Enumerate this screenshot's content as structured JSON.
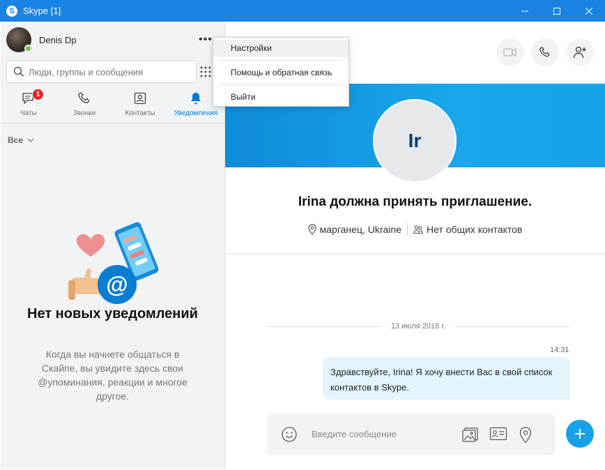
{
  "window": {
    "title": "Skype [1]",
    "app_icon": "S"
  },
  "profile": {
    "name": "Denis Dp",
    "status_color": "#6cc24a",
    "more_label": "•••"
  },
  "search": {
    "placeholder": "Люди, группы и сообщения"
  },
  "tabs": [
    {
      "label": "Чаты",
      "icon": "chat-icon",
      "badge": "1"
    },
    {
      "label": "Звонки",
      "icon": "phone-icon"
    },
    {
      "label": "Контакты",
      "icon": "contacts-icon"
    },
    {
      "label": "Уведомления",
      "icon": "bell-icon",
      "active": true
    }
  ],
  "filter": {
    "label": "Все"
  },
  "empty_state": {
    "title": "Нет новых уведомлений",
    "description": "Когда вы начнете общаться в Скайпе, вы увидите здесь свои @упоминания, реакции и многое другое."
  },
  "menu": {
    "items": [
      {
        "label": "Настройки",
        "highlighted": true
      },
      {
        "label": "Помощь и обратная связь"
      },
      {
        "label": "Выйти"
      }
    ]
  },
  "contact": {
    "initials": "Ir",
    "invite_title": "Irina должна принять приглашение.",
    "location": "марганец, Ukraine",
    "mutual": "Нет общих контактов"
  },
  "conversation": {
    "date": "13 июля 2018 г.",
    "message_time": "14:31",
    "message_text": "Здравствуйте, Irina! Я хочу внести Вас в свой список контактов в Skype."
  },
  "composer": {
    "placeholder": "Введите сообщение"
  },
  "colors": {
    "accent": "#0078d4",
    "titlebar": "#1a82e2",
    "banner": "#15a0e6",
    "badge": "#e3242b",
    "bubble": "#e3f4fd"
  }
}
